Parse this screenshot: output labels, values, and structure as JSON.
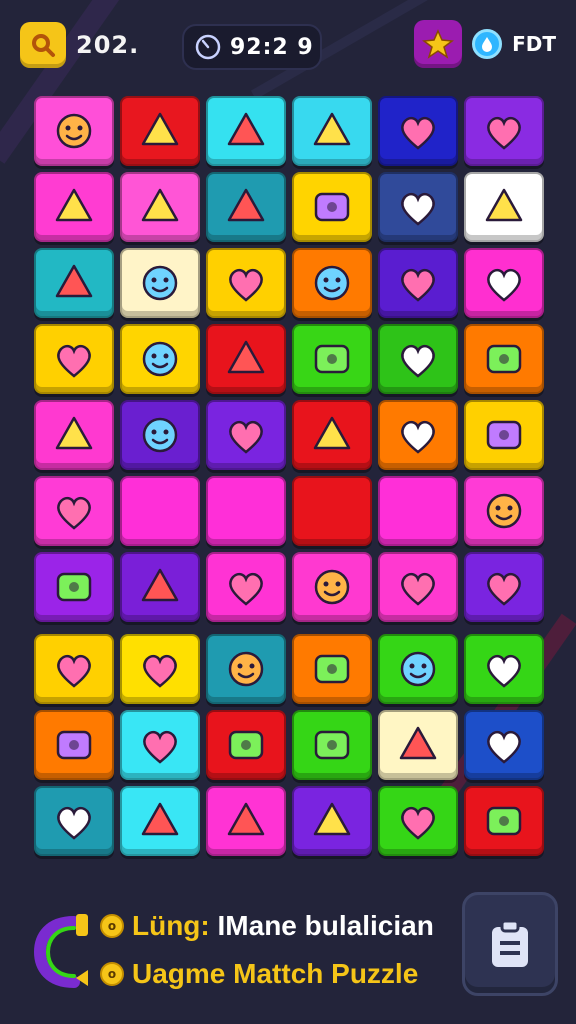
{
  "header": {
    "score": "202.",
    "timer": "92:2 9",
    "right_label": "FDT"
  },
  "board": {
    "rows": [
      [
        {
          "bg": "#ff4fd8",
          "icon": "sun-face-icon"
        },
        {
          "bg": "#e8171f",
          "icon": "ticket-icon"
        },
        {
          "bg": "#35e1f0",
          "icon": "star-face-icon"
        },
        {
          "bg": "#38d9ef",
          "icon": "wave-shell-icon"
        },
        {
          "bg": "#2023c9",
          "icon": "ghost-face-icon"
        },
        {
          "bg": "#8a2be2",
          "icon": "toolbox-icon"
        }
      ],
      [
        {
          "bg": "#ff3cd2",
          "icon": "frog-icon"
        },
        {
          "bg": "#ff55d6",
          "icon": "cat-face-icon"
        },
        {
          "bg": "#1f9bb0",
          "icon": "bag-icon"
        },
        {
          "bg": "#ffd400",
          "icon": "spiral-icon"
        },
        {
          "bg": "#304a9a",
          "icon": "purse-icon"
        },
        {
          "bg": "#ffffff",
          "icon": "sun-icon"
        }
      ],
      [
        {
          "bg": "#22b8c4",
          "icon": "stack-icon"
        },
        {
          "bg": "#fff4c8",
          "icon": "books-icon"
        },
        {
          "bg": "#ffd000",
          "icon": "box-icon"
        },
        {
          "bg": "#ff7a00",
          "icon": "compass-icon"
        },
        {
          "bg": "#5a1dd0",
          "icon": "color-pin-icon"
        },
        {
          "bg": "#ff2fd0",
          "icon": "arrow-up-icon"
        }
      ],
      [
        {
          "bg": "#ffd000",
          "icon": "van-icon"
        },
        {
          "bg": "#ffd500",
          "icon": "robot-icon"
        },
        {
          "bg": "#e8141c",
          "icon": "envelope-icon"
        },
        {
          "bg": "#38d616",
          "icon": "location-pin-icon"
        },
        {
          "bg": "#2ec318",
          "icon": "swirl-icon"
        },
        {
          "bg": "#ff7a00",
          "icon": "pot-face-icon"
        }
      ],
      [
        {
          "bg": "#ff39d0",
          "icon": "map-icon"
        },
        {
          "bg": "#6a1fd0",
          "icon": "bucket-icon"
        },
        {
          "bg": "#7a24e0",
          "icon": "paper-plane-icon"
        },
        {
          "bg": "#e8141c",
          "icon": "book-stack-icon"
        },
        {
          "bg": "#ff7a00",
          "icon": "ball-icon"
        },
        {
          "bg": "#ffd000",
          "icon": "handbag-icon"
        }
      ],
      [
        {
          "bg": "#ff3bd6",
          "icon": "heart-bubble-icon"
        },
        {
          "bg": "#ff2fd8",
          "icon": ""
        },
        {
          "bg": "#ff2fd8",
          "icon": ""
        },
        {
          "bg": "#e8141c",
          "icon": ""
        },
        {
          "bg": "#ff2fd8",
          "icon": ""
        },
        {
          "bg": "#ff3bd6",
          "icon": "heart-icon"
        }
      ],
      [
        {
          "bg": "#9b24e8",
          "icon": "cube-icon"
        },
        {
          "bg": "#7a1fd8",
          "icon": "apple-face-icon"
        },
        {
          "bg": "#ff33d4",
          "icon": "radio-icon"
        },
        {
          "bg": "#ff39d0",
          "icon": "leaf-icon"
        },
        {
          "bg": "#ff39d0",
          "icon": "gear-face-icon"
        },
        {
          "bg": "#7a24e0",
          "icon": "pencil-box-icon"
        }
      ],
      [
        {
          "bg": "#ffd000",
          "icon": "dragon-icon"
        },
        {
          "bg": "#ffe000",
          "icon": "feather-icon"
        },
        {
          "bg": "#1f9bb0",
          "icon": "cookie-face-icon"
        },
        {
          "bg": "#ff7a00",
          "icon": "face-icon"
        },
        {
          "bg": "#35d616",
          "icon": "calculator-icon"
        },
        {
          "bg": "#35d616",
          "icon": "heart-card-icon"
        }
      ],
      [
        {
          "bg": "#ff7a00",
          "icon": "shield-icon"
        },
        {
          "bg": "#39e6f5",
          "icon": "flower-icon"
        },
        {
          "bg": "#e8141c",
          "icon": "skull-face-icon"
        },
        {
          "bg": "#35d616",
          "icon": "blob-face-icon"
        },
        {
          "bg": "#fff6c4",
          "icon": "crossed-pencils-icon"
        },
        {
          "bg": "#1d4fc9",
          "icon": "wreath-face-icon"
        }
      ],
      [
        {
          "bg": "#1f9bb0",
          "icon": "red-box-icon"
        },
        {
          "bg": "#39e6f5",
          "icon": "tooth-icon"
        },
        {
          "bg": "#ff33d4",
          "icon": "smile-icon"
        },
        {
          "bg": "#7a24e0",
          "icon": "bear-icon"
        },
        {
          "bg": "#35d616",
          "icon": "moon-g-icon"
        },
        {
          "bg": "#e8141c",
          "icon": "camera-icon"
        }
      ]
    ]
  },
  "footer": {
    "line1_prefix": "Lüng:",
    "line1_rest": "IMane bulalician",
    "line2": "Uagme Mattch Puzzle"
  }
}
